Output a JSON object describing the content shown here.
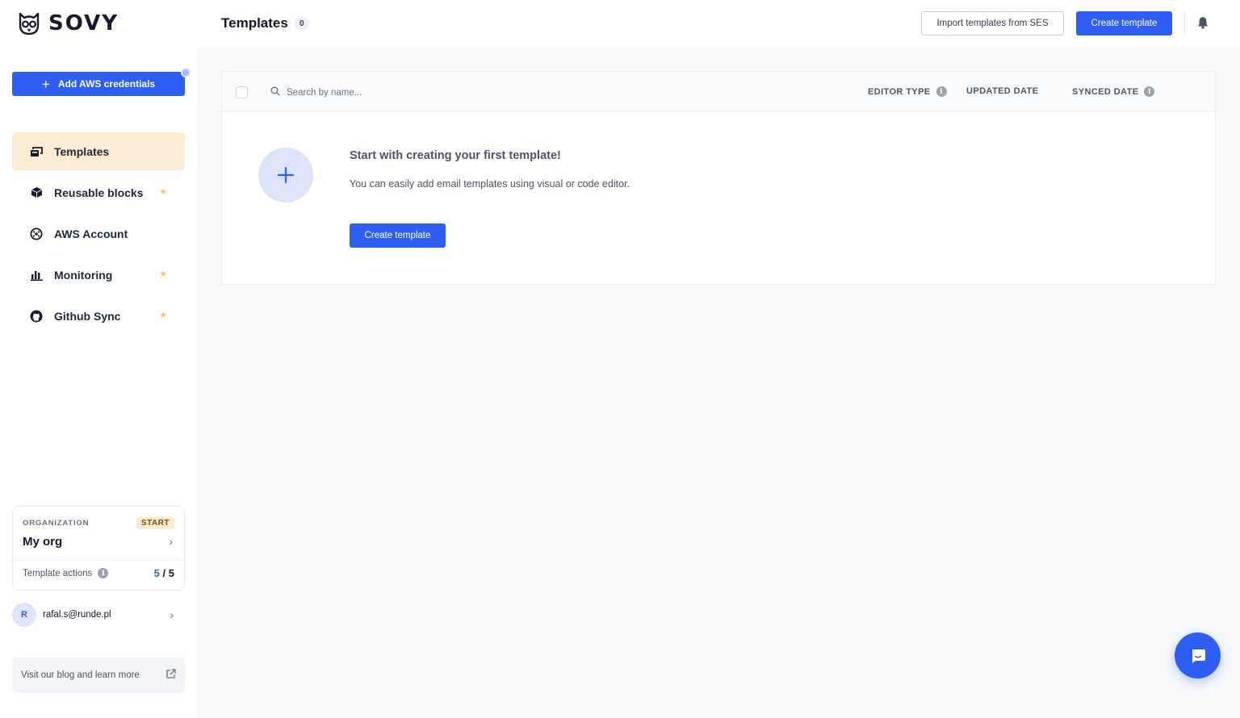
{
  "brand": {
    "name": "SOVY"
  },
  "sidebar": {
    "add_aws_label": "Add AWS credentials",
    "items": [
      {
        "label": "Templates",
        "icon": "templates-icon",
        "active": true,
        "star": false
      },
      {
        "label": "Reusable blocks",
        "icon": "cube-icon",
        "active": false,
        "star": true
      },
      {
        "label": "AWS Account",
        "icon": "aws-account-icon",
        "active": false,
        "star": false
      },
      {
        "label": "Monitoring",
        "icon": "bar-chart-icon",
        "active": false,
        "star": true
      },
      {
        "label": "Github Sync",
        "icon": "github-icon",
        "active": false,
        "star": true
      }
    ],
    "organization": {
      "label": "ORGANIZATION",
      "plan_badge": "START",
      "name": "My org",
      "actions_label": "Template actions",
      "actions_used": "5",
      "actions_total": "/ 5"
    },
    "user": {
      "initial": "R",
      "email": "rafal.s@runde.pl"
    },
    "blog_link": "Visit our blog and learn more"
  },
  "header": {
    "title": "Templates",
    "count": "0",
    "import_label": "Import templates from SES",
    "create_label": "Create template"
  },
  "table": {
    "search_placeholder": "Search by name...",
    "columns": {
      "editor_type": "EDITOR TYPE",
      "updated_date": "UPDATED DATE",
      "synced_date": "SYNCED DATE"
    }
  },
  "empty_state": {
    "title": "Start with creating your first template!",
    "description": "You can easily add email templates using visual or code editor.",
    "button_label": "Create template"
  },
  "colors": {
    "primary": "#2f5ef4",
    "active_nav": "#fdecd4",
    "star": "#f5c46b"
  }
}
